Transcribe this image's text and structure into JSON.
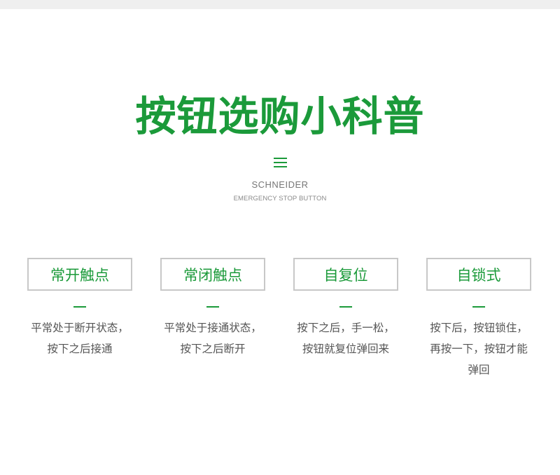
{
  "title": "按钮选购小科普",
  "brand": "SCHNEIDER",
  "subtitle": "EMERGENCY STOP BUTTON",
  "accent_color": "#1b9a3a",
  "features": [
    {
      "label": "常开触点",
      "desc": "平常处于断开状态，按下之后接通"
    },
    {
      "label": "常闭触点",
      "desc": "平常处于接通状态，按下之后断开"
    },
    {
      "label": "自复位",
      "desc": "按下之后，手一松，按钮就复位弹回来"
    },
    {
      "label": "自锁式",
      "desc": "按下后，按钮锁住，再按一下，按钮才能弹回"
    }
  ]
}
